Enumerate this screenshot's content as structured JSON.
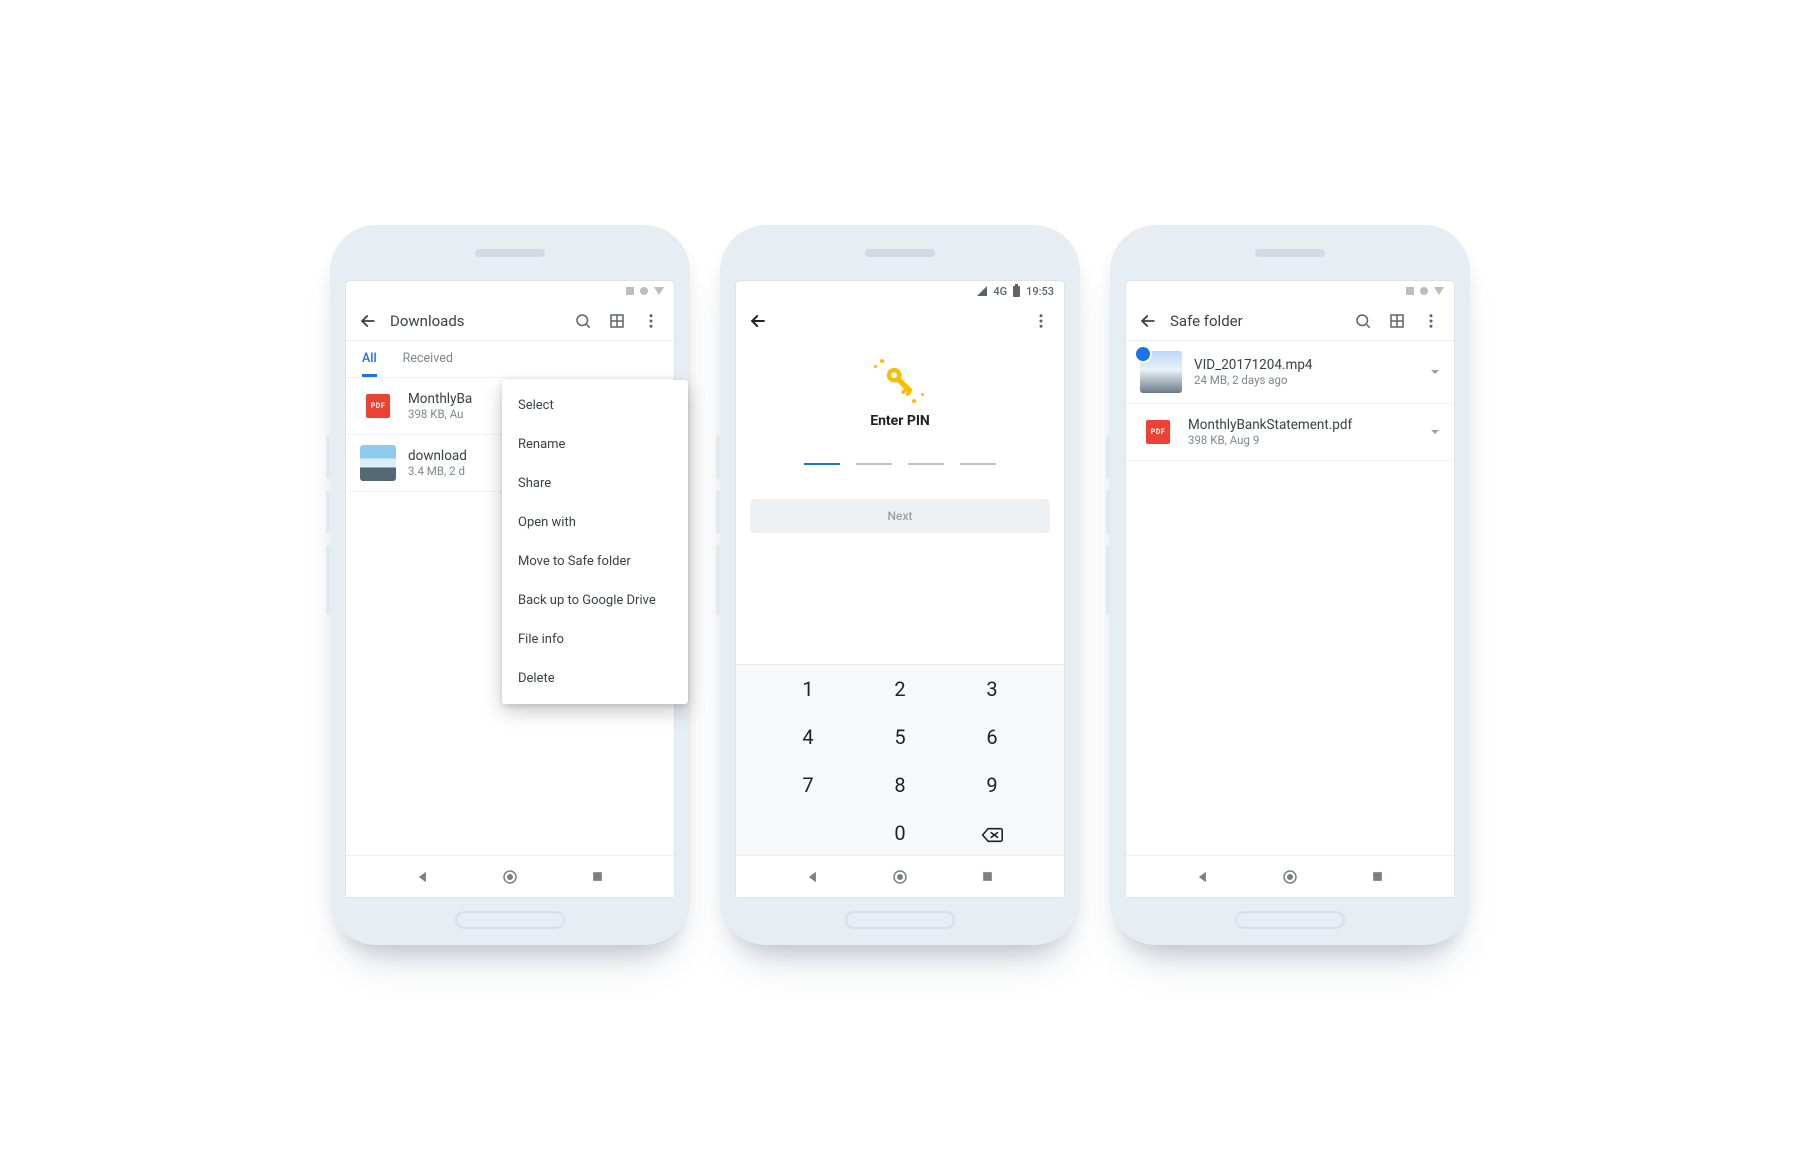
{
  "screen1": {
    "title": "Downloads",
    "tabs": {
      "all": "All",
      "received": "Received"
    },
    "files": [
      {
        "name": "MonthlyBa",
        "meta": "398 KB, Au"
      },
      {
        "name": "download",
        "meta": "3.4 MB, 2 d"
      }
    ],
    "menu": {
      "select": "Select",
      "rename": "Rename",
      "share": "Share",
      "open_with": "Open with",
      "move_safe": "Move to Safe folder",
      "backup": "Back up to Google Drive",
      "file_info": "File info",
      "delete": "Delete"
    }
  },
  "screen2": {
    "status": {
      "net": "4G",
      "time": "19:53"
    },
    "title": "Enter PIN",
    "next": "Next",
    "keypad": {
      "k1": "1",
      "k2": "2",
      "k3": "3",
      "k4": "4",
      "k5": "5",
      "k6": "6",
      "k7": "7",
      "k8": "8",
      "k9": "9",
      "k0": "0"
    }
  },
  "screen3": {
    "title": "Safe folder",
    "files": [
      {
        "name": "VID_20171204.mp4",
        "meta": "24 MB, 2 days ago"
      },
      {
        "name": "MonthlyBankStatement.pdf",
        "meta": "398 KB, Aug 9"
      }
    ]
  },
  "icons": {
    "pdf": "PDF"
  }
}
